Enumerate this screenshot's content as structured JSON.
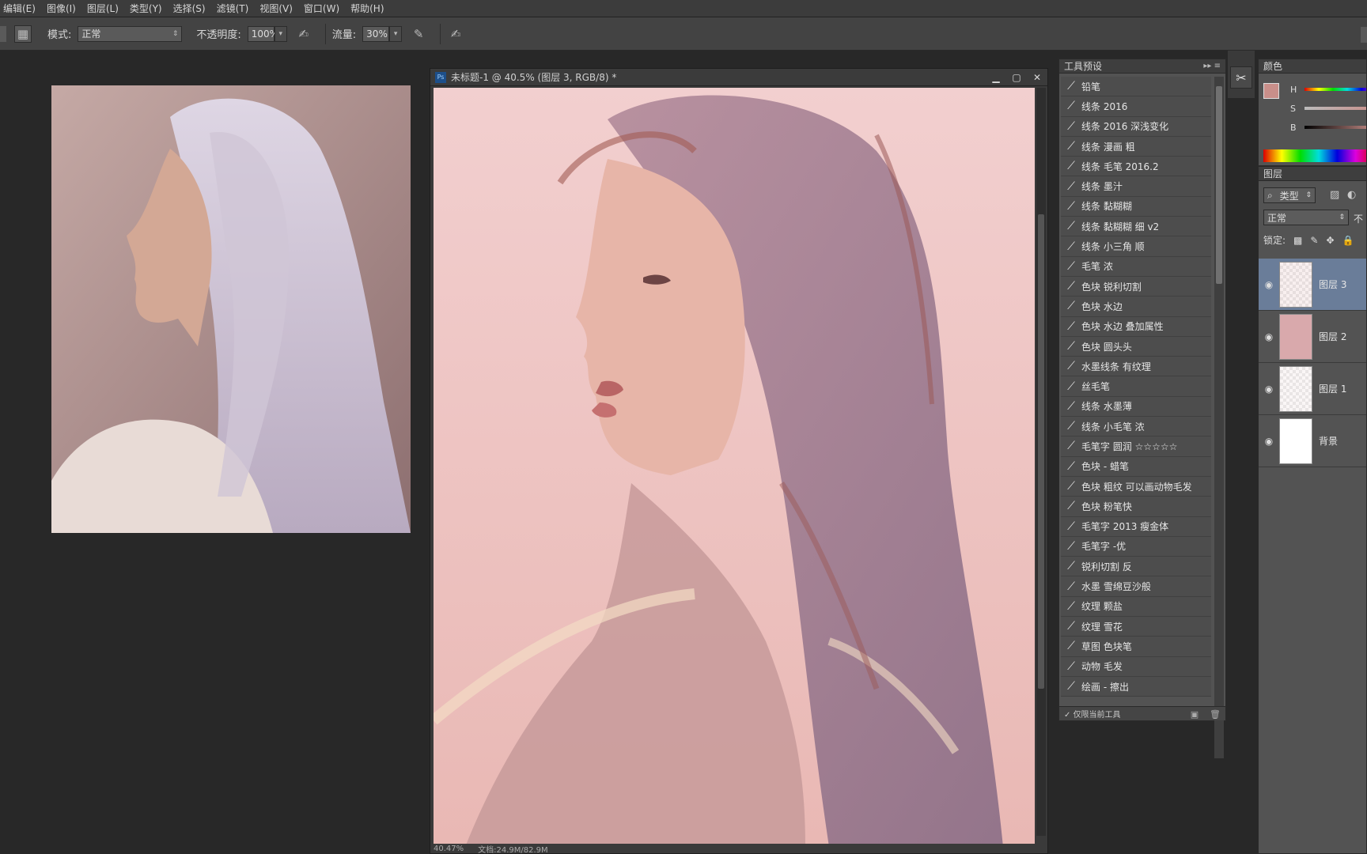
{
  "menu": [
    "编辑(E)",
    "图像(I)",
    "图层(L)",
    "类型(Y)",
    "选择(S)",
    "滤镜(T)",
    "视图(V)",
    "窗口(W)",
    "帮助(H)"
  ],
  "options": {
    "mode_label": "模式:",
    "mode_value": "正常",
    "opacity_label": "不透明度:",
    "opacity_value": "100%",
    "flow_label": "流量:",
    "flow_value": "30%"
  },
  "document": {
    "title": "未标题-1 @ 40.5% (图层 3, RGB/8) *",
    "status_zoom": "40.47%",
    "status_doc": "文档:24.9M/82.9M"
  },
  "presets": {
    "tab": "工具预设",
    "items": [
      "铅笔",
      "线条 2016",
      "线条 2016 深浅变化",
      "线条 漫画 粗",
      "线条 毛笔 2016.2",
      "线条 墨汁",
      "线条 黏糊糊",
      "线条 黏糊糊 细 v2",
      "线条 小三角 顺",
      "毛笔 浓",
      "色块 锐利切割",
      "色块 水边",
      "色块 水边 叠加属性",
      "色块 圆头头",
      "水墨线条 有纹理",
      "丝毛笔",
      "线条 水墨薄",
      "线条 小毛笔 浓",
      "毛笔字 圆润 ☆☆☆☆☆",
      "色块 - 蜡笔",
      "色块 粗纹 可以画动物毛发",
      "色块 粉笔快",
      "毛笔字 2013 瘦金体",
      "毛笔字 -优",
      "锐利切割 反",
      "水墨 雪绵豆沙般",
      "纹理 颗盐",
      "纹理 雪花",
      "草图 色块笔",
      "动物 毛发",
      "绘画 - 擦出"
    ],
    "footer_checkbox": "仅限当前工具"
  },
  "color_panel": {
    "tab": "颜色",
    "labels": [
      "H",
      "S",
      "B"
    ],
    "foreground": "#c98f8a"
  },
  "layers_panel": {
    "tab": "图层",
    "filter_value": "类型",
    "blend_value": "正常",
    "opacity_short": "不",
    "lock_label": "锁定:",
    "layers": [
      {
        "name": "图层 3",
        "active": true
      },
      {
        "name": "图层 2",
        "active": false
      },
      {
        "name": "图层 1",
        "active": false
      },
      {
        "name": "背景",
        "active": false
      }
    ]
  }
}
